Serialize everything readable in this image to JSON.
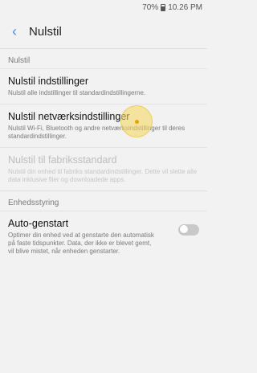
{
  "status_bar": {
    "battery": "70%",
    "time": "10.26 PM"
  },
  "app_bar": {
    "title": "Nulstil"
  },
  "sections": [
    {
      "header": "Nulstil",
      "items": [
        {
          "title": "Nulstil indstillinger",
          "desc": "Nulstil alle indstillinger til standardindstillingerne."
        },
        {
          "title": "Nulstil netværksindstillinger",
          "desc": "Nulstil Wi-Fi, Bluetooth og andre netværksindstillinger til deres standardindstillinger."
        },
        {
          "title": "Nulstil til fabriksstandard",
          "desc": "Nulstil din enhed til fabriks standardindstillinger. Dette vil slette alle data inklusive filer og downloadede apps."
        }
      ]
    },
    {
      "header": "Enhedsstyring",
      "items": [
        {
          "title": "Auto-genstart",
          "desc": "Optimer din enhed ved at genstarte den automatisk på faste tidspunkter. Data, der ikke er blevet gemt, vil blive mistet, når enheden genstarter."
        }
      ]
    }
  ]
}
